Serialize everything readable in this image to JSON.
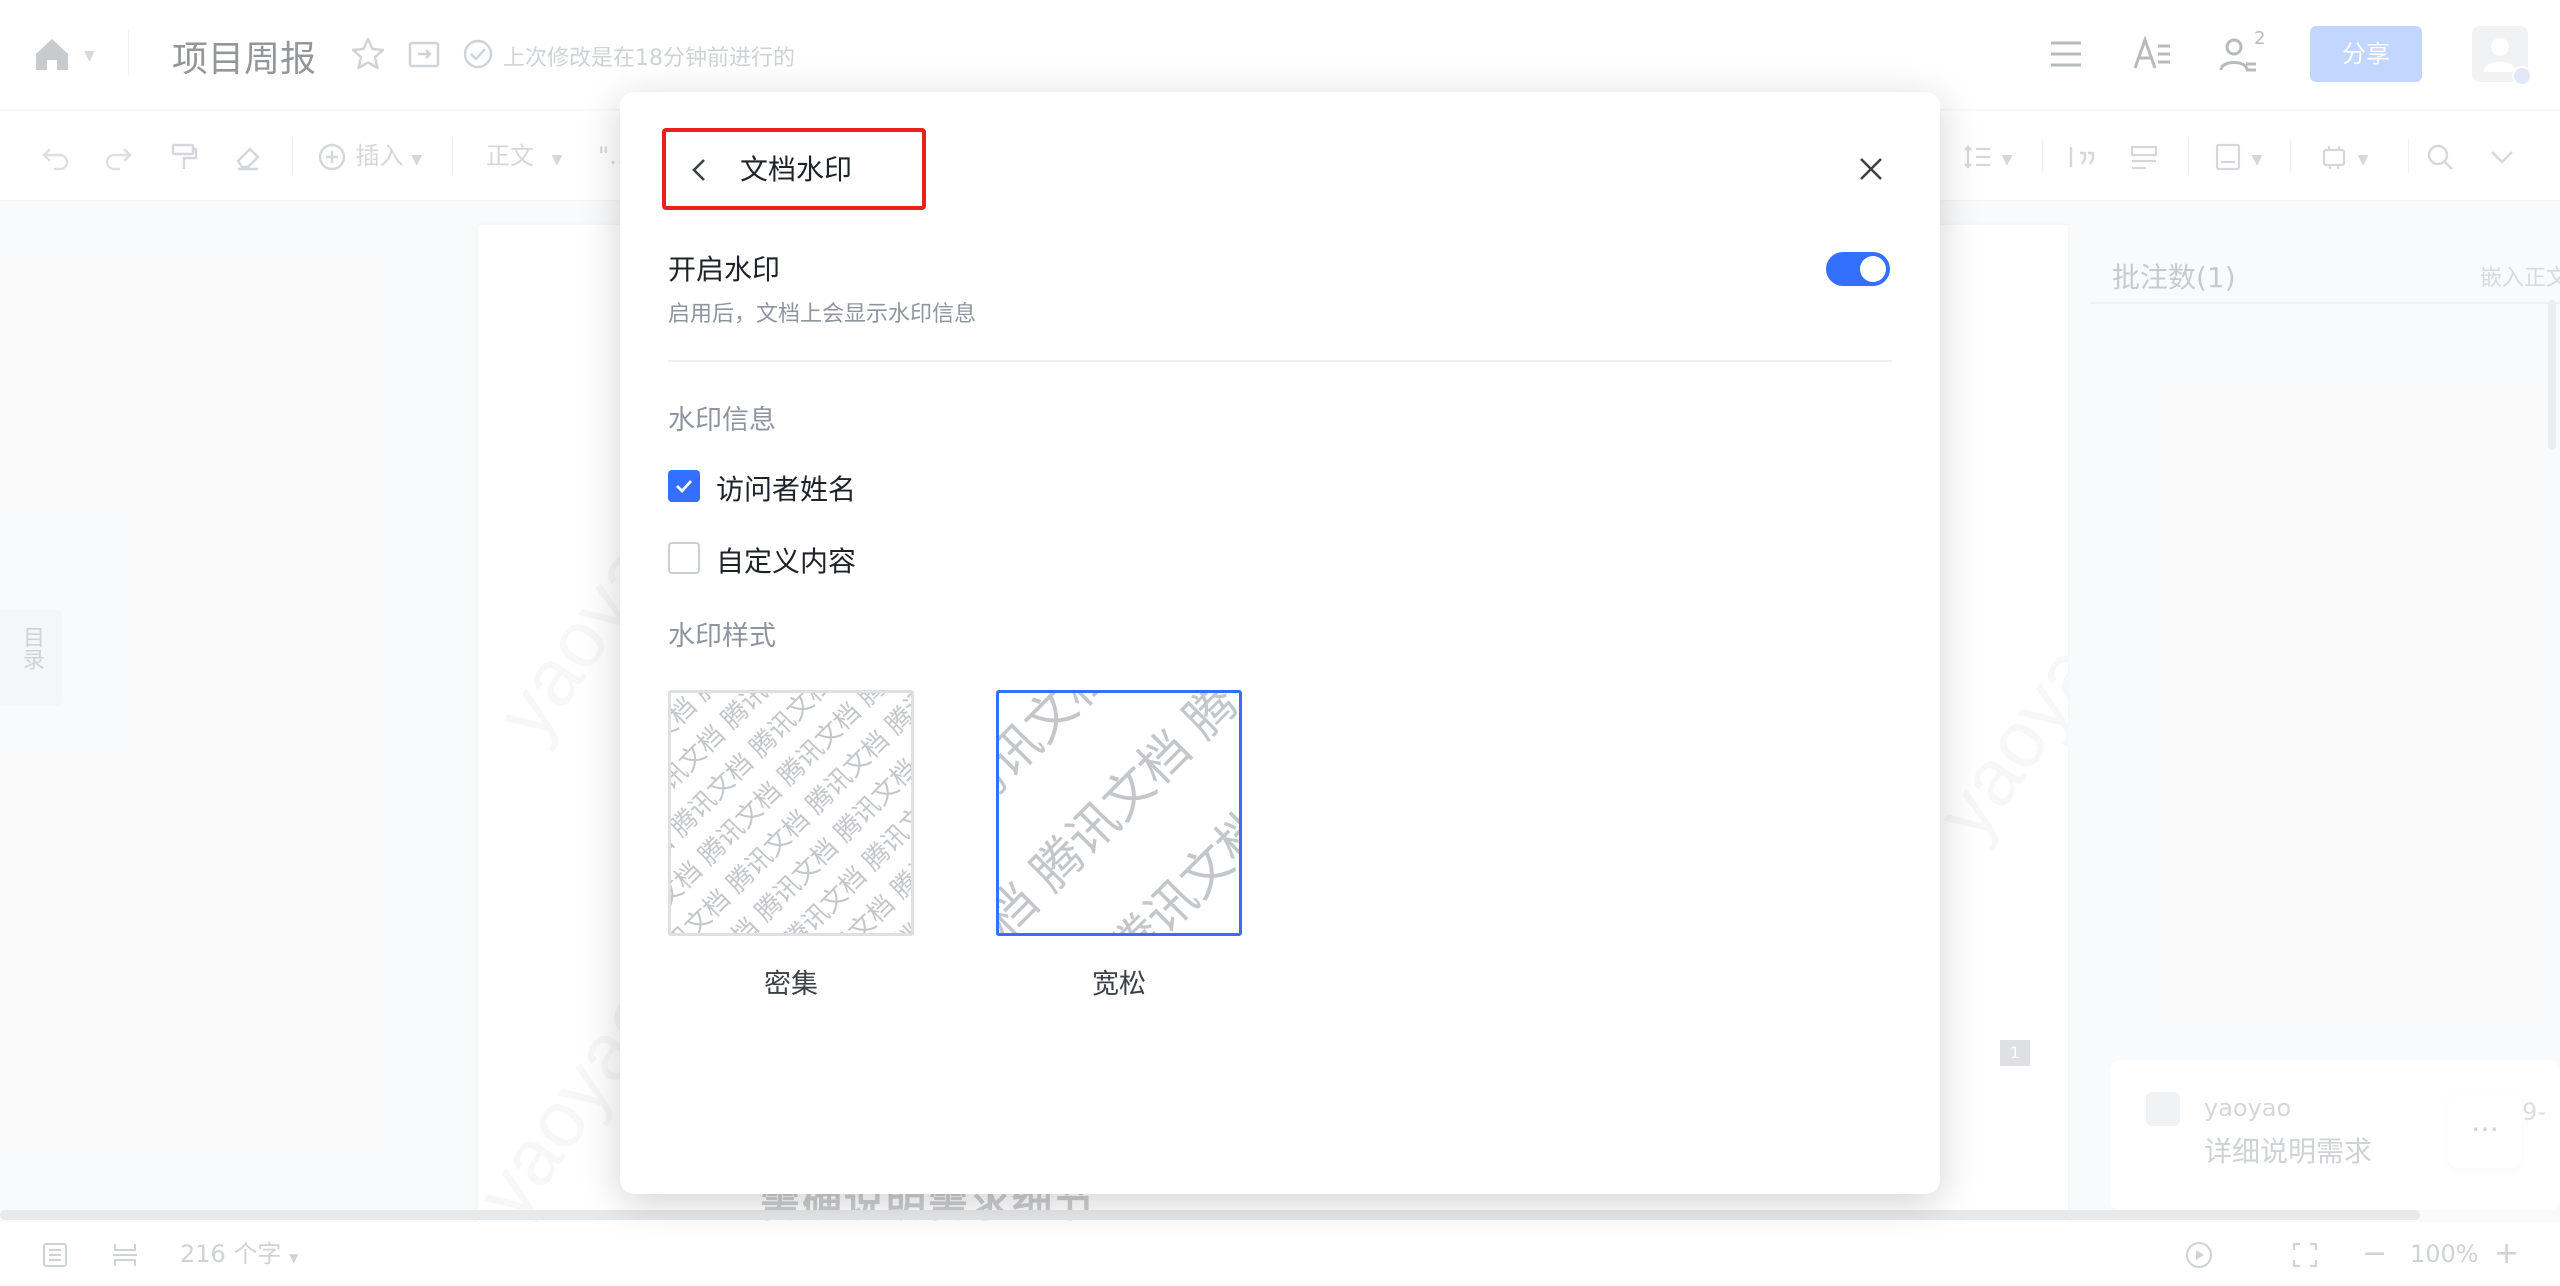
{
  "header": {
    "doc_title": "项目周报",
    "last_edit": "上次修改是在18分钟前进行的",
    "collab_count": "2",
    "share_label": "分享"
  },
  "toolbar": {
    "insert_label": "插入",
    "style_label": "正文",
    "quote_label": "\"…"
  },
  "document": {
    "toc_label": "目录",
    "page_number": "1",
    "body_fragment": "需确说明需求细节"
  },
  "comments": {
    "title": "批注数(1)",
    "embed_label": "嵌入正文",
    "items": [
      {
        "author": "yaoyao",
        "text": "详细说明需求",
        "date": "9-"
      }
    ]
  },
  "statusbar": {
    "word_count": "216 个字",
    "zoom": "100%"
  },
  "dialog": {
    "title": "文档水印",
    "enable_label": "开启水印",
    "enable_desc": "启用后，文档上会显示水印信息",
    "enabled": true,
    "info_section": "水印信息",
    "options": [
      {
        "label": "访问者姓名",
        "checked": true
      },
      {
        "label": "自定义内容",
        "checked": false
      }
    ],
    "style_section": "水印样式",
    "styles": [
      {
        "label": "密集",
        "selected": false
      },
      {
        "label": "宽松",
        "selected": true
      }
    ],
    "watermark_text": "腾讯文档",
    "accent_color": "#3370ff",
    "highlight_color": "#e8211d"
  },
  "background_watermark": "yaoyao"
}
